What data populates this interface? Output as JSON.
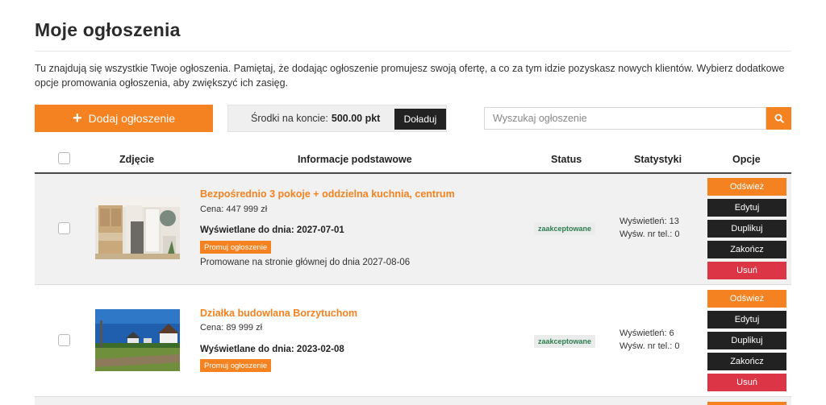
{
  "page": {
    "title": "Moje ogłoszenia",
    "intro": "Tu znajdują się wszystkie Twoje ogłoszenia. Pamiętaj, że dodając ogłoszenie promujesz swoją ofertę, a co za tym idzie pozyskasz nowych klientów. Wybierz dodatkowe opcje promowania ogłoszenia, aby zwiększyć ich zasięg."
  },
  "toolbar": {
    "add_label": "Dodaj ogłoszenie",
    "balance_label": "Środki na koncie:",
    "balance_value": "500.00 pkt",
    "topup_label": "Doładuj",
    "search_placeholder": "Wyszukaj ogłoszenie"
  },
  "table": {
    "headers": {
      "photo": "Zdjęcie",
      "info": "Informacje podstawowe",
      "status": "Status",
      "stats": "Statystyki",
      "options": "Opcje"
    },
    "rows": [
      {
        "title": "Bezpośrednio 3 pokoje + oddzielna kuchnia, centrum",
        "price": "Cena: 447 999 zł",
        "shown_until": "Wyświetlane do dnia: 2027-07-01",
        "promo_button": "Promuj ogłoszenie",
        "promo_note": "Promowane na stronie głównej do dnia 2027-08-06",
        "status": "zaakceptowane",
        "views": "Wyświetleń: 13",
        "phone_views": "Wyśw. nr tel.: 0"
      },
      {
        "title": "Działka budowlana Borzytuchom",
        "price": "Cena: 89 999 zł",
        "shown_until": "Wyświetlane do dnia: 2023-02-08",
        "promo_button": "Promuj ogłoszenie",
        "status": "zaakceptowane",
        "views": "Wyświetleń: 6",
        "phone_views": "Wyśw. nr tel.: 0"
      }
    ],
    "options": {
      "refresh": "Odśwież",
      "edit": "Edytuj",
      "duplicate": "Duplikuj",
      "finish": "Zakończ",
      "delete": "Usuń"
    }
  },
  "colors": {
    "accent": "#f58220",
    "dark": "#222222",
    "danger": "#dc3545",
    "status_text": "#2e7d4f"
  }
}
